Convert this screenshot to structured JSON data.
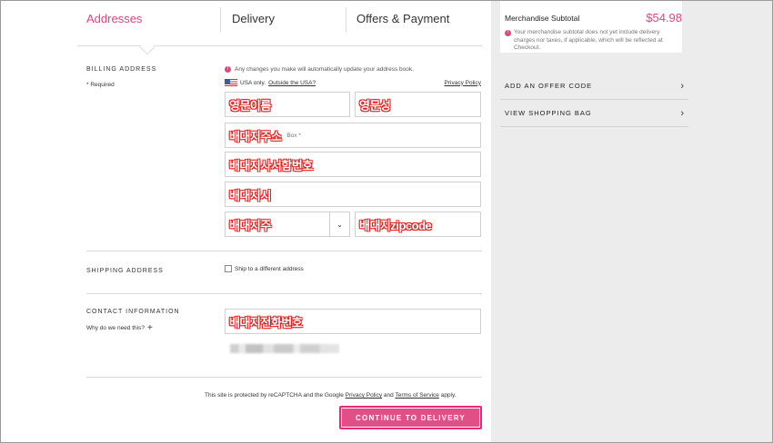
{
  "tabs": [
    {
      "label": "Addresses",
      "active": true
    },
    {
      "label": "Delivery",
      "active": false
    },
    {
      "label": "Offers & Payment",
      "active": false
    }
  ],
  "billing": {
    "title": "BILLING ADDRESS",
    "required": "* Required",
    "notice": "Any changes you make will automatically update your address book.",
    "usa_only": "USA only.",
    "outside_usa": "Outside the USA?",
    "privacy_policy": "Privacy Policy",
    "fields": {
      "first_name": "영문이름",
      "last_name": "영문성",
      "address1": "배대지주소",
      "address1_hint": "Box *",
      "address2": "배대지사서함번호",
      "city": "배대지시",
      "state": "배대지주",
      "zip": "배대지zipcode"
    }
  },
  "shipping": {
    "title": "SHIPPING ADDRESS",
    "checkbox_label": "Ship to a different address"
  },
  "contact": {
    "title": "CONTACT INFORMATION",
    "why": "Why do we need this?",
    "plus": "+",
    "phone": "배대지전화번호"
  },
  "footer": {
    "recaptcha_pre": "This site is protected by reCAPTCHA and the Google",
    "privacy": "Privacy Policy",
    "and": "and",
    "terms": "Terms of Service",
    "apply": "apply.",
    "cta": "CONTINUE TO DELIVERY"
  },
  "summary": {
    "label": "Merchandise Subtotal",
    "value": "$54.98",
    "note": "Your merchandise subtotal does not yet include delivery charges nor taxes, if applicable, which will be reflected at Checkout.",
    "links": [
      "ADD AN OFFER CODE",
      "VIEW SHOPPING BAG"
    ]
  },
  "icons": {
    "info": "info-icon",
    "chevron": "chevron-right-icon",
    "flag": "us-flag-icon",
    "caret": "chevron-down-icon"
  },
  "colors": {
    "accent": "#e0457b",
    "panel": "#ececec",
    "overlay_red": "#e21d1d"
  }
}
